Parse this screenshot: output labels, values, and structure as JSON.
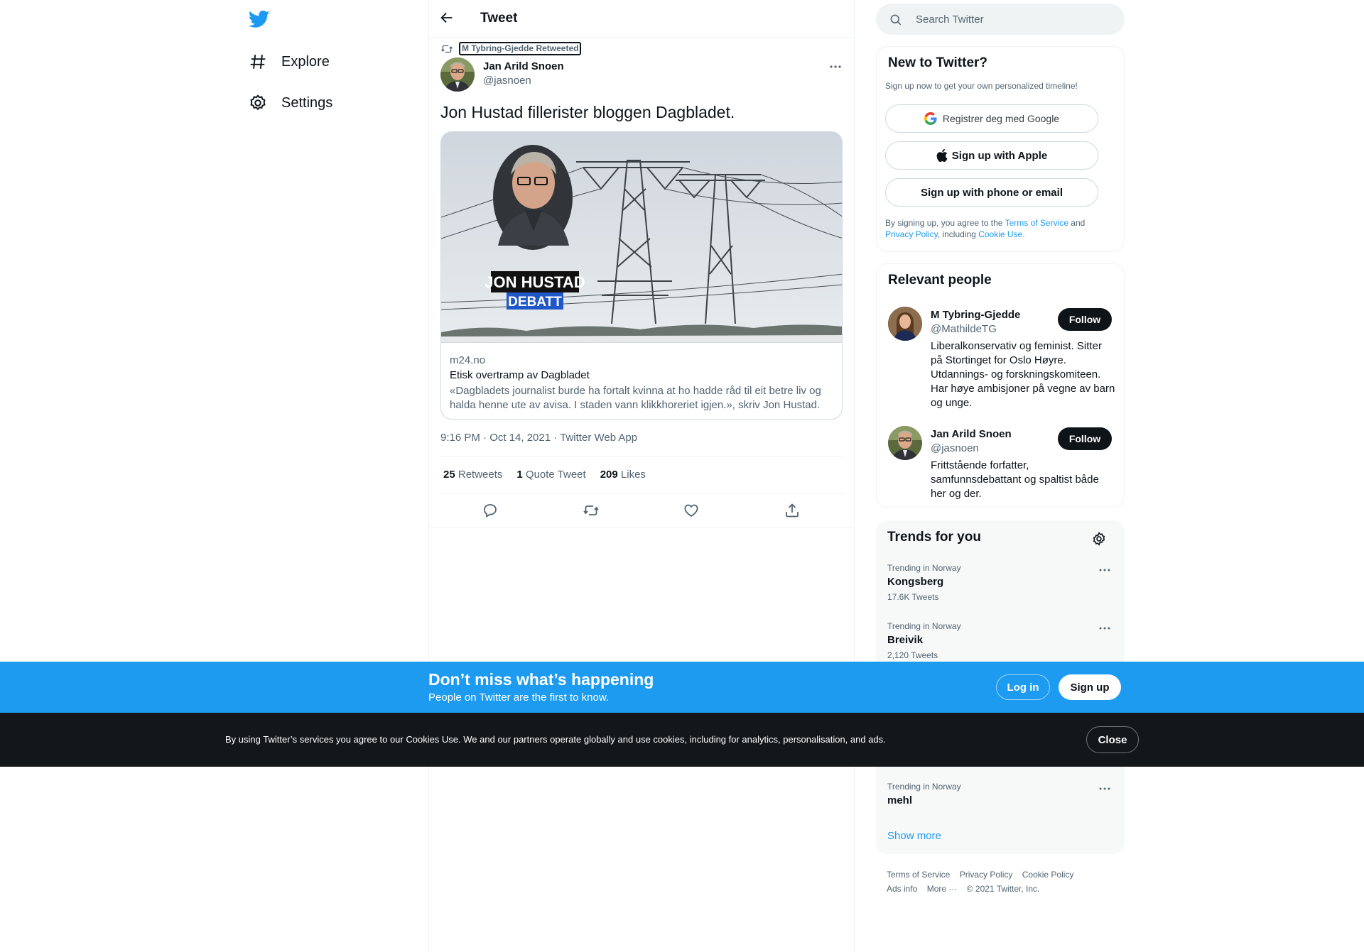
{
  "nav": {
    "explore_label": "Explore",
    "settings_label": "Settings"
  },
  "header": {
    "title": "Tweet"
  },
  "tweet": {
    "retweeted_by": "M Tybring-Gjedde Retweeted",
    "author_name": "Jan Arild Snoen",
    "author_handle": "@jasnoen",
    "text": "Jon Hustad fillerister bloggen Dagbladet.",
    "card": {
      "image_title_line1": "JON HUSTAD",
      "image_title_line2": "DEBATT",
      "domain": "m24.no",
      "title": "Etisk overtramp av Dagbladet",
      "description": "«Dagbladets journalist burde ha fortalt kvinna at ho hadde råd til eit betre liv og halda henne ute av avisa. I staden vann klikkhoreriet igjen.», skriv Jon Hustad."
    },
    "meta": "9:16 PM · Oct 14, 2021 · Twitter Web App",
    "stats": {
      "retweets_count": "25",
      "retweets_label": "Retweets",
      "quotes_count": "1",
      "quotes_label": "Quote Tweet",
      "likes_count": "209",
      "likes_label": "Likes"
    }
  },
  "search": {
    "placeholder": "Search Twitter"
  },
  "new_to_twitter": {
    "title": "New to Twitter?",
    "subtitle": "Sign up now to get your own personalized timeline!",
    "google_label": "Registrer deg med Google",
    "apple_label": "Sign up with Apple",
    "phone_label": "Sign up with phone or email",
    "legal_prefix": "By signing up, you agree to the",
    "terms_link": "Terms of Service",
    "and": "and",
    "privacy_link": "Privacy Policy",
    "including": ", including",
    "cookie_link": "Cookie Use."
  },
  "relevant_people": {
    "title": "Relevant people",
    "people": [
      {
        "name": "M Tybring-Gjedde",
        "handle": "@MathildeTG",
        "bio": "Liberalkonservativ og feminist. Sitter på Stortinget for Oslo Høyre. Utdannings- og forskningskomiteen. Har høye ambisjoner på vegne av barn og unge.",
        "follow_label": "Follow"
      },
      {
        "name": "Jan Arild Snoen",
        "handle": "@jasnoen",
        "bio": "Frittstående forfatter, samfunnsdebattant og spaltist både her og der.",
        "follow_label": "Follow"
      }
    ]
  },
  "trends": {
    "title": "Trends for you",
    "items": [
      {
        "context": "Trending in Norway",
        "name": "Kongsberg",
        "count": "17.6K Tweets"
      },
      {
        "context": "Trending in Norway",
        "name": "Breivik",
        "count": "2,120 Tweets"
      },
      {
        "context": "Trending in Norway",
        "name": "mehl",
        "count": ""
      }
    ],
    "show_more": "Show more"
  },
  "footer": {
    "terms": "Terms of Service",
    "privacy": "Privacy Policy",
    "cookie": "Cookie Policy",
    "ads": "Ads info",
    "more": "More ···",
    "copyright": "© 2021 Twitter, Inc."
  },
  "bottom_bar": {
    "title": "Don’t miss what’s happening",
    "subtitle": "People on Twitter are the first to know.",
    "login_label": "Log in",
    "signup_label": "Sign up"
  },
  "cookie_bar": {
    "text": "By using Twitter’s services you agree to our Cookies Use. We and our partners operate globally and use cookies, including for analytics, personalisation, and ads.",
    "close_label": "Close"
  },
  "colors": {
    "brand_blue": "#1d9bf0",
    "text_primary": "#0f1419",
    "text_secondary": "#536471",
    "cookie_bar_bg": "#14171a"
  }
}
